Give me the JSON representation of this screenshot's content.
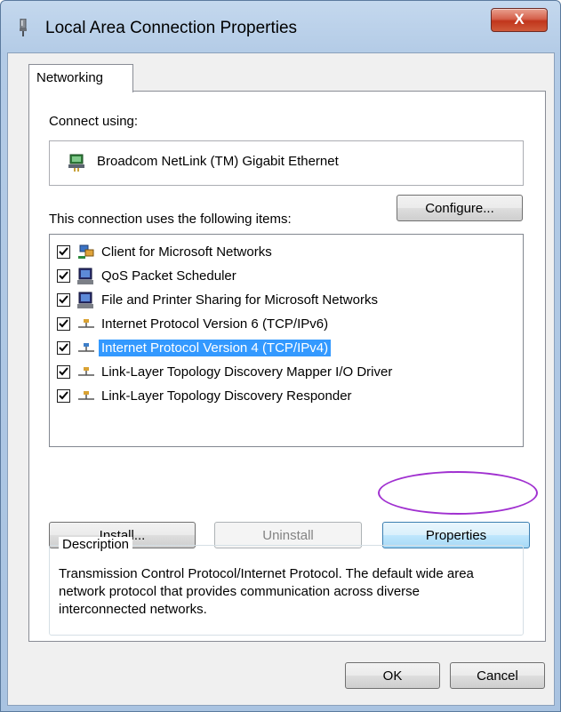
{
  "window": {
    "title": "Local Area Connection Properties",
    "close_glyph": "X"
  },
  "tabs": [
    {
      "label": "Networking"
    }
  ],
  "connect": {
    "label": "Connect using:",
    "adapter": "Broadcom NetLink (TM) Gigabit Ethernet",
    "configure_label": "Configure..."
  },
  "items": {
    "header": "This connection uses the following items:",
    "list": [
      {
        "label": "Client for Microsoft Networks",
        "icon": "network-client-icon",
        "checked": true
      },
      {
        "label": "QoS Packet Scheduler",
        "icon": "service-icon",
        "checked": true
      },
      {
        "label": "File and Printer Sharing for Microsoft Networks",
        "icon": "service-icon",
        "checked": true
      },
      {
        "label": "Internet Protocol Version 6 (TCP/IPv6)",
        "icon": "protocol-icon",
        "checked": true
      },
      {
        "label": "Internet Protocol Version 4 (TCP/IPv4)",
        "icon": "protocol-icon",
        "checked": true,
        "selected": true
      },
      {
        "label": "Link-Layer Topology Discovery Mapper I/O Driver",
        "icon": "protocol-icon",
        "checked": true
      },
      {
        "label": "Link-Layer Topology Discovery Responder",
        "icon": "protocol-icon",
        "checked": true
      }
    ]
  },
  "buttons": {
    "install": "Install...",
    "uninstall": "Uninstall",
    "properties": "Properties",
    "ok": "OK",
    "cancel": "Cancel"
  },
  "description": {
    "legend": "Description",
    "text": "Transmission Control Protocol/Internet Protocol. The default wide area network protocol that provides communication across diverse interconnected networks."
  },
  "colors": {
    "selection": "#3399ff",
    "highlight_ring": "#a030d0",
    "close_button": "#c1361c"
  }
}
